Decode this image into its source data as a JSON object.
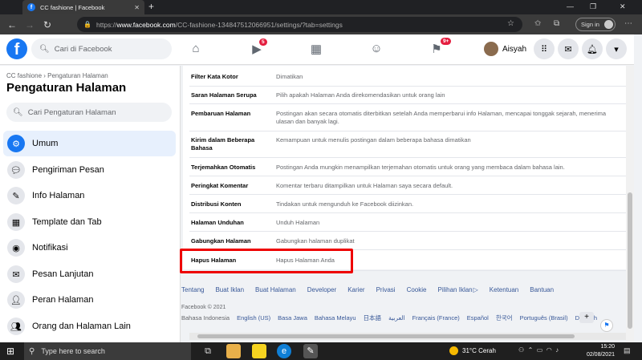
{
  "browser": {
    "tab_title": "CC fashione | Facebook",
    "url_prefix": "https://",
    "url_domain": "www.facebook.com",
    "url_path": "/CC-fashione-134847512066951/settings/?tab=settings",
    "sign_in": "Sign in"
  },
  "fb": {
    "search_placeholder": "Cari di Facebook",
    "badges": {
      "watch": "5",
      "notifications": "9+"
    },
    "profile_name": "Aisyah"
  },
  "sidebar": {
    "breadcrumb": "CC fashione › Pengaturan Halaman",
    "title": "Pengaturan Halaman",
    "search_placeholder": "Cari Pengaturan Halaman",
    "items": [
      {
        "label": "Umum",
        "icon": "gear-icon"
      },
      {
        "label": "Pengiriman Pesan",
        "icon": "chat-icon"
      },
      {
        "label": "Info Halaman",
        "icon": "pencil-icon"
      },
      {
        "label": "Template dan Tab",
        "icon": "grid-icon"
      },
      {
        "label": "Notifikasi",
        "icon": "globe-icon"
      },
      {
        "label": "Pesan Lanjutan",
        "icon": "messenger-icon"
      },
      {
        "label": "Peran Halaman",
        "icon": "person-icon"
      },
      {
        "label": "Orang dan Halaman Lain",
        "icon": "people-icon"
      }
    ]
  },
  "settings": [
    {
      "name": "Filter Kata Kotor",
      "value": "Dimatikan"
    },
    {
      "name": "Saran Halaman Serupa",
      "value": "Pilih apakah Halaman Anda direkomendasikan untuk orang lain"
    },
    {
      "name": "Pembaruan Halaman",
      "value": "Postingan akan secara otomatis diterbitkan setelah Anda memperbarui info Halaman, mencapai tonggak sejarah, menerima ulasan dan banyak lagi."
    },
    {
      "name": "Kirim dalam Beberapa Bahasa",
      "value": "Kemampuan untuk menulis postingan dalam beberapa bahasa dimatikan"
    },
    {
      "name": "Terjemahkan Otomatis",
      "value": "Postingan Anda mungkin menampilkan terjemahan otomatis untuk orang yang membaca dalam bahasa lain."
    },
    {
      "name": "Peringkat Komentar",
      "value": "Komentar terbaru ditampilkan untuk Halaman saya secara default."
    },
    {
      "name": "Distribusi Konten",
      "value": "Tindakan untuk mengunduh ke Facebook diizinkan."
    },
    {
      "name": "Halaman Unduhan",
      "value": "Unduh Halaman"
    },
    {
      "name": "Gabungkan Halaman",
      "value": "Gabungkan halaman duplikat"
    },
    {
      "name": "Hapus Halaman",
      "value": "Hapus Halaman Anda"
    }
  ],
  "footer": {
    "links": [
      "Tentang",
      "Buat Iklan",
      "Buat Halaman",
      "Developer",
      "Karier",
      "Privasi",
      "Cookie",
      "Pilihan Iklan",
      "Ketentuan",
      "Bantuan"
    ],
    "copyright": "Facebook © 2021",
    "current_language": "Bahasa Indonesia",
    "languages": [
      "English (US)",
      "Basa Jawa",
      "Bahasa Melayu",
      "日本語",
      "العربية",
      "Français (France)",
      "Español",
      "한국어",
      "Português (Brasil)",
      "Deutsch"
    ]
  },
  "taskbar": {
    "search_placeholder": "Type here to search",
    "temperature": "31°C",
    "weather": "Cerah",
    "time": "15:20",
    "date": "02/08/2021"
  }
}
